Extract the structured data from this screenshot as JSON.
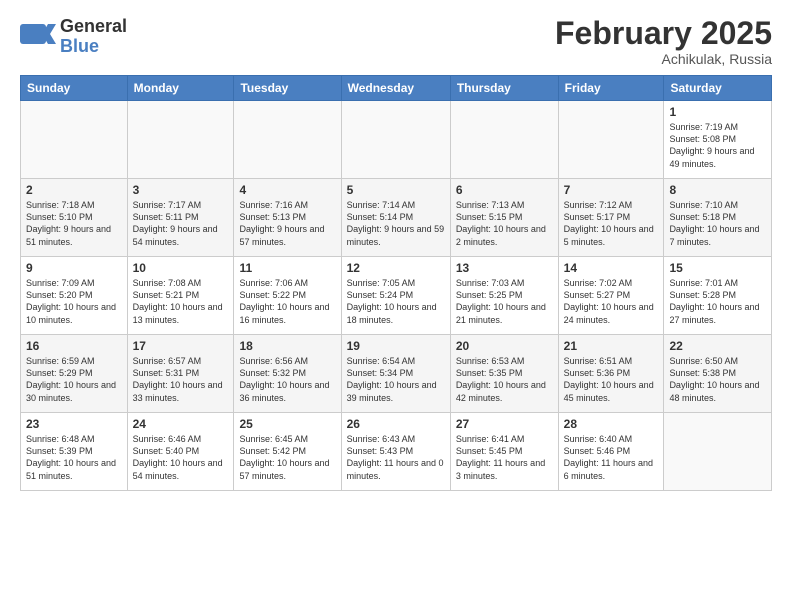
{
  "logo": {
    "general": "General",
    "blue": "Blue"
  },
  "header": {
    "month": "February 2025",
    "location": "Achikulak, Russia"
  },
  "days_of_week": [
    "Sunday",
    "Monday",
    "Tuesday",
    "Wednesday",
    "Thursday",
    "Friday",
    "Saturday"
  ],
  "weeks": [
    [
      {
        "day": "",
        "info": ""
      },
      {
        "day": "",
        "info": ""
      },
      {
        "day": "",
        "info": ""
      },
      {
        "day": "",
        "info": ""
      },
      {
        "day": "",
        "info": ""
      },
      {
        "day": "",
        "info": ""
      },
      {
        "day": "1",
        "info": "Sunrise: 7:19 AM\nSunset: 5:08 PM\nDaylight: 9 hours and 49 minutes."
      }
    ],
    [
      {
        "day": "2",
        "info": "Sunrise: 7:18 AM\nSunset: 5:10 PM\nDaylight: 9 hours and 51 minutes."
      },
      {
        "day": "3",
        "info": "Sunrise: 7:17 AM\nSunset: 5:11 PM\nDaylight: 9 hours and 54 minutes."
      },
      {
        "day": "4",
        "info": "Sunrise: 7:16 AM\nSunset: 5:13 PM\nDaylight: 9 hours and 57 minutes."
      },
      {
        "day": "5",
        "info": "Sunrise: 7:14 AM\nSunset: 5:14 PM\nDaylight: 9 hours and 59 minutes."
      },
      {
        "day": "6",
        "info": "Sunrise: 7:13 AM\nSunset: 5:15 PM\nDaylight: 10 hours and 2 minutes."
      },
      {
        "day": "7",
        "info": "Sunrise: 7:12 AM\nSunset: 5:17 PM\nDaylight: 10 hours and 5 minutes."
      },
      {
        "day": "8",
        "info": "Sunrise: 7:10 AM\nSunset: 5:18 PM\nDaylight: 10 hours and 7 minutes."
      }
    ],
    [
      {
        "day": "9",
        "info": "Sunrise: 7:09 AM\nSunset: 5:20 PM\nDaylight: 10 hours and 10 minutes."
      },
      {
        "day": "10",
        "info": "Sunrise: 7:08 AM\nSunset: 5:21 PM\nDaylight: 10 hours and 13 minutes."
      },
      {
        "day": "11",
        "info": "Sunrise: 7:06 AM\nSunset: 5:22 PM\nDaylight: 10 hours and 16 minutes."
      },
      {
        "day": "12",
        "info": "Sunrise: 7:05 AM\nSunset: 5:24 PM\nDaylight: 10 hours and 18 minutes."
      },
      {
        "day": "13",
        "info": "Sunrise: 7:03 AM\nSunset: 5:25 PM\nDaylight: 10 hours and 21 minutes."
      },
      {
        "day": "14",
        "info": "Sunrise: 7:02 AM\nSunset: 5:27 PM\nDaylight: 10 hours and 24 minutes."
      },
      {
        "day": "15",
        "info": "Sunrise: 7:01 AM\nSunset: 5:28 PM\nDaylight: 10 hours and 27 minutes."
      }
    ],
    [
      {
        "day": "16",
        "info": "Sunrise: 6:59 AM\nSunset: 5:29 PM\nDaylight: 10 hours and 30 minutes."
      },
      {
        "day": "17",
        "info": "Sunrise: 6:57 AM\nSunset: 5:31 PM\nDaylight: 10 hours and 33 minutes."
      },
      {
        "day": "18",
        "info": "Sunrise: 6:56 AM\nSunset: 5:32 PM\nDaylight: 10 hours and 36 minutes."
      },
      {
        "day": "19",
        "info": "Sunrise: 6:54 AM\nSunset: 5:34 PM\nDaylight: 10 hours and 39 minutes."
      },
      {
        "day": "20",
        "info": "Sunrise: 6:53 AM\nSunset: 5:35 PM\nDaylight: 10 hours and 42 minutes."
      },
      {
        "day": "21",
        "info": "Sunrise: 6:51 AM\nSunset: 5:36 PM\nDaylight: 10 hours and 45 minutes."
      },
      {
        "day": "22",
        "info": "Sunrise: 6:50 AM\nSunset: 5:38 PM\nDaylight: 10 hours and 48 minutes."
      }
    ],
    [
      {
        "day": "23",
        "info": "Sunrise: 6:48 AM\nSunset: 5:39 PM\nDaylight: 10 hours and 51 minutes."
      },
      {
        "day": "24",
        "info": "Sunrise: 6:46 AM\nSunset: 5:40 PM\nDaylight: 10 hours and 54 minutes."
      },
      {
        "day": "25",
        "info": "Sunrise: 6:45 AM\nSunset: 5:42 PM\nDaylight: 10 hours and 57 minutes."
      },
      {
        "day": "26",
        "info": "Sunrise: 6:43 AM\nSunset: 5:43 PM\nDaylight: 11 hours and 0 minutes."
      },
      {
        "day": "27",
        "info": "Sunrise: 6:41 AM\nSunset: 5:45 PM\nDaylight: 11 hours and 3 minutes."
      },
      {
        "day": "28",
        "info": "Sunrise: 6:40 AM\nSunset: 5:46 PM\nDaylight: 11 hours and 6 minutes."
      },
      {
        "day": "",
        "info": ""
      }
    ]
  ]
}
